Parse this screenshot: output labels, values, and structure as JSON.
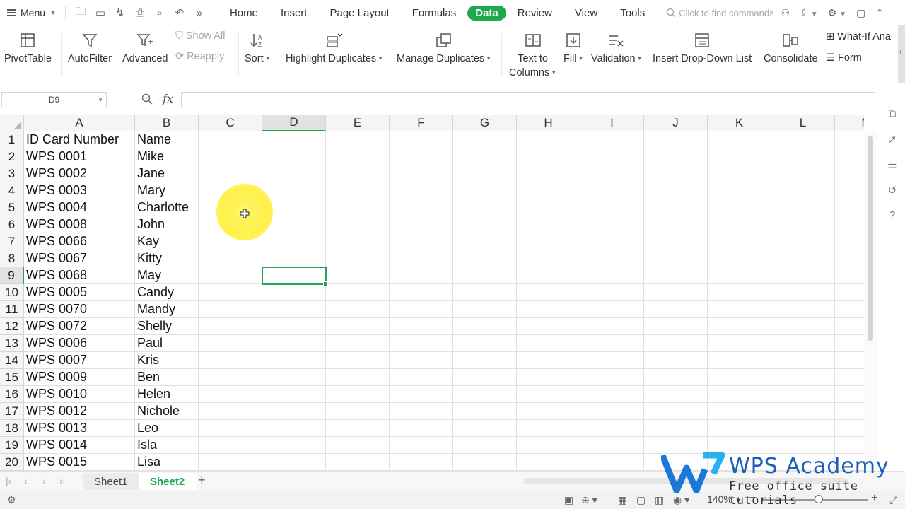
{
  "menubar": {
    "menu_label": "Menu",
    "tabs": [
      "Home",
      "Insert",
      "Page Layout",
      "Formulas",
      "Data",
      "Review",
      "View",
      "Tools"
    ],
    "active_tab": "Data",
    "search_placeholder": "Click to find commands"
  },
  "ribbon": {
    "pivot": "PivotTable",
    "autofilter": "AutoFilter",
    "advanced": "Advanced",
    "show_all": "Show All",
    "reapply": "Reapply",
    "sort": "Sort",
    "highlight_duplicates": "Highlight Duplicates",
    "manage_duplicates": "Manage Duplicates",
    "text_to_columns_1": "Text to",
    "text_to_columns_2": "Columns",
    "fill": "Fill",
    "validation": "Validation",
    "dropdown": "Insert Drop-Down List",
    "consolidate": "Consolidate",
    "whatif": "What-If Ana",
    "form": "Form"
  },
  "formula": {
    "name_box": "D9",
    "fx": "fx",
    "value": ""
  },
  "grid": {
    "columns": [
      "A",
      "B",
      "C",
      "D",
      "E",
      "F",
      "G",
      "H",
      "I",
      "J",
      "K",
      "L",
      "M"
    ],
    "rows": [
      [
        "ID Card Number",
        "Name"
      ],
      [
        "WPS 0001",
        "Mike"
      ],
      [
        "WPS 0002",
        "Jane"
      ],
      [
        "WPS 0003",
        "Mary"
      ],
      [
        "WPS 0004",
        "Charlotte"
      ],
      [
        "WPS 0008",
        "John"
      ],
      [
        "WPS 0066",
        "Kay"
      ],
      [
        "WPS 0067",
        "Kitty"
      ],
      [
        "WPS 0068",
        "May"
      ],
      [
        "WPS 0005",
        "Candy"
      ],
      [
        "WPS 0070",
        "Mandy"
      ],
      [
        "WPS 0072",
        "Shelly"
      ],
      [
        "WPS 0006",
        "Paul"
      ],
      [
        "WPS 0007",
        "Kris"
      ],
      [
        "WPS 0009",
        "Ben"
      ],
      [
        "WPS 0010",
        "Helen"
      ],
      [
        "WPS 0012",
        "Nichole"
      ],
      [
        "WPS 0013",
        "Leo"
      ],
      [
        "WPS 0014",
        "Isla"
      ],
      [
        "WPS 0015",
        "Lisa"
      ]
    ],
    "selected_cell": "D9"
  },
  "sheets": {
    "tabs": [
      "Sheet1",
      "Sheet2"
    ],
    "active": "Sheet2"
  },
  "status": {
    "zoom": "140%"
  },
  "watermark": {
    "title": "WPS Academy",
    "subtitle": "Free office suite tutorials"
  },
  "colors": {
    "accent": "#1fa84f",
    "brand": "#1b5fb8"
  }
}
